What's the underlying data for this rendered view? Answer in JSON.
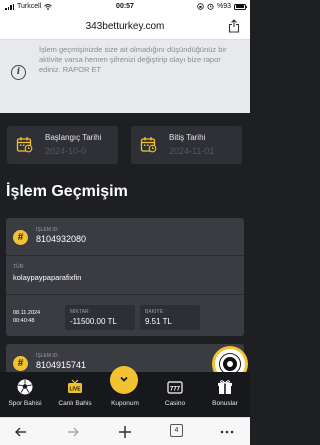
{
  "status_bar": {
    "carrier": "Turkcell",
    "time": "00:57",
    "battery": "%93"
  },
  "browser": {
    "url": "343betturkey.com",
    "tab_count": "4"
  },
  "notice": {
    "text": "İşlem geçmişinizde size ait olmadığını düşündüğünüz bir aktivite varsa hemen şifrenizi değiştirip olayı bize rapor ediniz. RAPOR ET"
  },
  "filters": {
    "start_label": "Başlangıç Tarihi",
    "start_value": "2024-10-0",
    "end_label": "Bitiş Tarihi",
    "end_value": "2024-11-01"
  },
  "section_title": "İşlem Geçmişim",
  "transactions": [
    {
      "id_label": "İŞLEM ID:",
      "id": "8104932080",
      "type_label": "TÜR:",
      "type": "kolaypaypaparafixfin",
      "date": "08.11.2024",
      "time": "00:40:48",
      "amount_label": "MİKTAR:",
      "amount": "-11500.00 TL",
      "balance_label": "BAKİYE:",
      "balance": "9.51 TL"
    },
    {
      "id_label": "İŞLEM ID:",
      "id": "8104915741"
    }
  ],
  "bottom_nav": [
    {
      "label": "Spor Bahisi",
      "icon": "soccer-ball-icon"
    },
    {
      "label": "Canlı Bahis",
      "icon": "live-tv-icon"
    },
    {
      "label": "Kuponum",
      "icon": "coupon-chevron-icon"
    },
    {
      "label": "Casino",
      "icon": "slot-777-icon"
    },
    {
      "label": "Bonuslar",
      "icon": "gift-icon"
    }
  ],
  "colors": {
    "accent": "#f2c230",
    "background": "#1e1f22",
    "card": "#3b3c42"
  }
}
